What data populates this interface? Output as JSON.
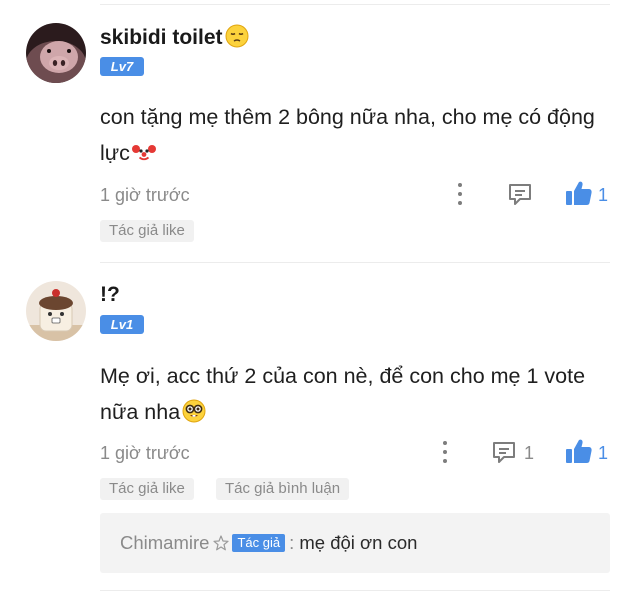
{
  "comments": [
    {
      "username": "skibidi toilet",
      "username_emoji_icon": "pensive-face-icon",
      "level": "Lv7",
      "content": "con tặng mẹ thêm 2 bông nữa nha, cho mẹ có động lực",
      "content_emoji_icon": "clown-face-icon",
      "time": "1 giờ trước",
      "reply_count": "",
      "like_count": "1",
      "tags": [
        "Tác giả like"
      ]
    },
    {
      "username": "!?",
      "level": "Lv1",
      "content": "Mẹ ơi, acc thứ 2 của con nè, để con cho mẹ 1 vote nữa nha",
      "content_emoji_icon": "nerd-face-icon",
      "time": "1 giờ trước",
      "reply_count": "1",
      "like_count": "1",
      "tags": [
        "Tác giả like",
        "Tác giả bình luận"
      ],
      "reply": {
        "author": "Chimamire",
        "badge": "Tác giả",
        "separator": ":",
        "text": "mẹ đội ơn con"
      }
    }
  ],
  "colors": {
    "accent": "#4a8ee6",
    "muted": "#8a8a8a",
    "tag_bg": "#f1f1f1"
  }
}
